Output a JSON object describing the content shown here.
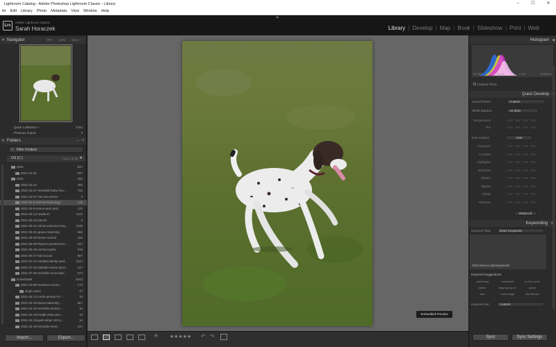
{
  "window": {
    "title": "Lightroom Catalog - Adobe Photoshop Lightroom Classic - Library",
    "controls": [
      "–",
      "☐",
      "✕"
    ]
  },
  "menu": [
    "ile",
    "Edit",
    "Library",
    "Photo",
    "Metadata",
    "View",
    "Window",
    "Help"
  ],
  "identity": {
    "logo": "Lrc",
    "product": "Adobe Lightroom Classic",
    "user": "Sarah Horaczek"
  },
  "modules": [
    {
      "label": "Library",
      "active": true
    },
    {
      "label": "Develop"
    },
    {
      "label": "Map"
    },
    {
      "label": "Book"
    },
    {
      "label": "Slideshow"
    },
    {
      "label": "Print"
    },
    {
      "label": "Web"
    }
  ],
  "navigator": {
    "title": "Navigator",
    "zoom": [
      "FIT ÷",
      "100%",
      "300% ÷"
    ]
  },
  "catalog": [
    {
      "name": "Quick Collection +",
      "count": "2784"
    },
    {
      "name": "Previous Import",
      "count": "5"
    }
  ],
  "folders": {
    "title": "Folders",
    "filter_label": "Filter Folders",
    "drive": {
      "name": "OS (C:)",
      "space": "6.4 / 1.6 TB"
    },
    "rows": [
      {
        "name": "2021",
        "count": "837",
        "indent": 1
      },
      {
        "name": "2021-01-01",
        "count": "837",
        "indent": 2
      },
      {
        "name": "2021",
        "count": "492",
        "indent": 1
      },
      {
        "name": "2021-03-12",
        "count": "492",
        "indent": 2
      },
      {
        "name": "2021-03-27-marshall-baby-sho...",
        "count": "705",
        "indent": 2
      },
      {
        "name": "2021-03-27-vaccine-phone",
        "count": "5",
        "indent": 2
      },
      {
        "name": "2021-04-6-basma-heidi-dogs",
        "count": "146",
        "indent": 2,
        "selected": true
      },
      {
        "name": "2021-04-6-sonos-and-carts",
        "count": "122",
        "indent": 2
      },
      {
        "name": "2021-04-12-newborn",
        "count": "1182",
        "indent": 2
      },
      {
        "name": "2021-05-20-GEAR",
        "count": "5",
        "indent": 2
      },
      {
        "name": "2021-05-21-senior-pictures-may...",
        "count": "1336",
        "indent": 2
      },
      {
        "name": "2021-05-31-grace-maternity",
        "count": "866",
        "indent": 2
      },
      {
        "name": "2021-06-06-brown-school",
        "count": "420",
        "indent": 2
      },
      {
        "name": "2021-06-09-flowers-pentax-lens...",
        "count": "627",
        "indent": 2
      },
      {
        "name": "2021-06-18-versaci-party",
        "count": "919",
        "indent": 2
      },
      {
        "name": "2021-06-27-kid-vicious",
        "count": "887",
        "indent": 2
      },
      {
        "name": "2021-07-14-chelsea-family-wed...",
        "count": "1542",
        "indent": 2
      },
      {
        "name": "2021-07-25-isabelle-senior-phot...",
        "count": "447",
        "indent": 2
      },
      {
        "name": "2021-07-25-michelle-mora-bab...",
        "count": "574",
        "indent": 2
      },
      {
        "name": "Downloads",
        "count": "5342",
        "indent": 1
      },
      {
        "name": "2021-03-09-massive-scenic...",
        "count": "173",
        "indent": 2
      },
      {
        "name": "singh sams",
        "count": "37",
        "indent": 3
      },
      {
        "name": "2021-04-12-curtis-pentax-67-...",
        "count": "10",
        "indent": 2
      },
      {
        "name": "2021-04-18-laura-maternity-...",
        "count": "967",
        "indent": 2
      },
      {
        "name": "2021-04-18-michelle-pentax-...",
        "count": "10",
        "indent": 2
      },
      {
        "name": "2021-04-19-kodak-ektar-pen...",
        "count": "10",
        "indent": 2
      },
      {
        "name": "2021-04-19-park-ektar-100-p...",
        "count": "10",
        "indent": 2
      },
      {
        "name": "2021-04-19-michelle-ment...",
        "count": "247",
        "indent": 2
      }
    ]
  },
  "left_buttons": {
    "import": "Import...",
    "export": "Export..."
  },
  "center": {
    "embedded_preview": "Embedded Preview"
  },
  "histogram": {
    "title": "Histogram",
    "info": [
      "ISO 800",
      "50 mm",
      "f / 5.6",
      "1/1250 sec"
    ],
    "original": "Original Photo"
  },
  "quick_develop": {
    "title": "Quick Develop",
    "saved_preset": {
      "label": "Saved Preset",
      "value": "Custom"
    },
    "white_balance": {
      "label": "White Balance",
      "value": "As Shot"
    },
    "wb_sliders": [
      "Temperature",
      "Tint"
    ],
    "tone_control": {
      "label": "Tone Control",
      "auto": "Auto"
    },
    "tone_sliders": [
      "Exposure",
      "Contrast",
      "Highlights",
      "Shadows",
      "Whites",
      "Blacks",
      "Clarity",
      "Vibrance"
    ],
    "reset": "Reset All"
  },
  "keywording": {
    "title": "Keywording",
    "tags_label": "Keyword Tags",
    "tags_value": "Enter Keywords",
    "click_here": "Click here to add keywords",
    "suggestions_title": "Keyword Suggestions",
    "suggestions": [
      "swimming",
      "horizontal",
      "on the move",
      "nature",
      "large group of",
      "grace",
      "sea",
      "color image",
      "abundance"
    ],
    "set_label": "Keyword Set",
    "set_value": "Custom"
  },
  "right_buttons": {
    "sync": "Sync",
    "sync_settings": "Sync Settings"
  },
  "colors": {
    "accent": "#e6e6e6",
    "panel": "#2b2b2b",
    "grass": "#5b6f2f"
  }
}
